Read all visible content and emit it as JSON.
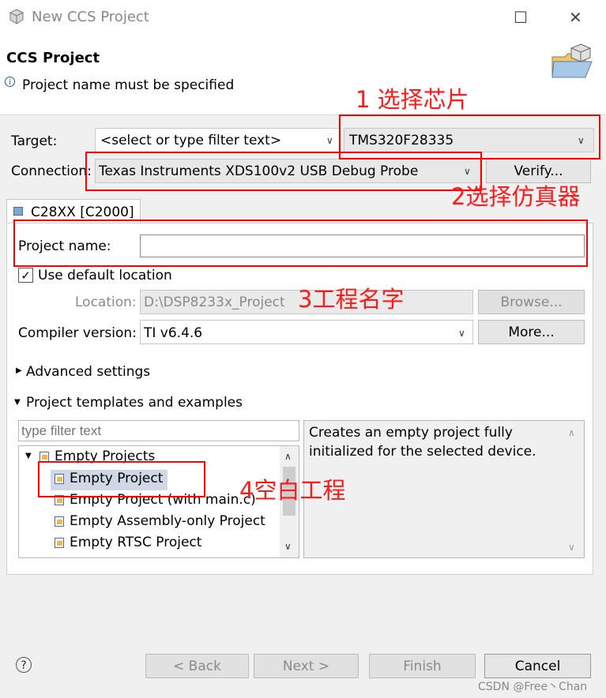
{
  "window": {
    "title": "New CCS Project",
    "minimize_glyph": "☐",
    "close_glyph": "✕"
  },
  "header": {
    "title": "CCS Project",
    "info_icon": "info-icon",
    "message": "Project name must be specified"
  },
  "target": {
    "label": "Target:",
    "filter_value": "<select or type filter text>",
    "device_value": "TMS320F28335"
  },
  "connection": {
    "label": "Connection:",
    "value": "Texas Instruments XDS100v2 USB Debug Probe",
    "verify_label": "Verify..."
  },
  "tab": {
    "label": "C28XX [C2000]"
  },
  "project": {
    "name_label": "Project name:",
    "name_value": "",
    "use_default_label": "Use default location",
    "use_default_checked": true,
    "location_label": "Location:",
    "location_value": "D:\\DSP8233x_Project",
    "browse_label": "Browse...",
    "compiler_label": "Compiler version:",
    "compiler_value": "TI v6.4.6",
    "more_label": "More..."
  },
  "sections": {
    "advanced": "Advanced settings",
    "templates": "Project templates and examples"
  },
  "templates": {
    "filter_placeholder": "type filter text",
    "group": "Empty Projects",
    "items": [
      "Empty Project",
      "Empty Project (with main.c)",
      "Empty Assembly-only Project",
      "Empty RTSC Project"
    ],
    "selected_index": 0,
    "description": [
      "Creates an empty project fully",
      "initialized for the selected device."
    ]
  },
  "footer": {
    "help_glyph": "?",
    "back_label": "< Back",
    "next_label": "Next >",
    "finish_label": "Finish",
    "cancel_label": "Cancel"
  },
  "annotations": {
    "a1": "1 选择芯片",
    "a2": "2选择仿真器",
    "a3": "3工程名字",
    "a4": "4空白工程"
  },
  "watermark": "CSDN @Free丶Chan",
  "colors": {
    "annotation_red": "#ff0000",
    "selection": "#cfd8e4"
  }
}
